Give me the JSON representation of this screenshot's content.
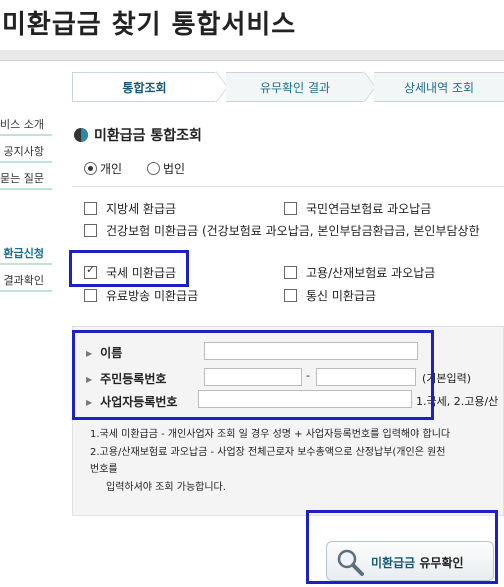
{
  "header": {
    "title": "미환급금 찾기 통합서비스"
  },
  "sidebar": {
    "items": [
      {
        "label": "비스 소개"
      },
      {
        "label": "공지사항"
      },
      {
        "label": "묻는 질문"
      },
      {
        "label": "환급신청"
      },
      {
        "label": "결과확인"
      }
    ]
  },
  "steps": [
    {
      "label": "통합조회"
    },
    {
      "label": "유무확인 결과"
    },
    {
      "label": "상세내역 조회"
    }
  ],
  "section": {
    "title": "미환급금 통합조회"
  },
  "person_type": {
    "options": [
      {
        "label": "개인",
        "checked": true
      },
      {
        "label": "법인",
        "checked": false
      }
    ]
  },
  "refunds": {
    "items": [
      {
        "label": "지방세 환급금",
        "checked": false
      },
      {
        "label": "국민연금보험료 과오납금",
        "checked": false
      },
      {
        "label": "건강보험 미환급금 (건강보험료 과오납금, 본인부담금환급금, 본인부담상한",
        "checked": false
      },
      {
        "label": "국세 미환급금",
        "checked": true
      },
      {
        "label": "고용/산재보험료 과오납금",
        "checked": false
      },
      {
        "label": "유료방송 미환급금",
        "checked": false
      },
      {
        "label": "통신 미환급금",
        "checked": false
      }
    ]
  },
  "form": {
    "name_label": "이름",
    "rrn_label": "주민등록번호",
    "rrn_separator": "-",
    "rrn_hint": "(기본입력)",
    "biz_label": "사업자등록번호",
    "biz_hint": "1.국세, 2.고용/산",
    "notes": [
      "1.국세 미환급금 - 개인사업자 조회 일 경우 성명 + 사업자등록번호를 입력해야 합니다",
      "2.고용/산재보험료 과오납금 - 사업장 전체근로자 보수총액으로 산정납부(개인은 원천",
      "번호를",
      "입력하셔야 조회 가능합니다."
    ]
  },
  "lookup_button": {
    "label_accent": "미환급금",
    "label_rest": "유무확인"
  }
}
